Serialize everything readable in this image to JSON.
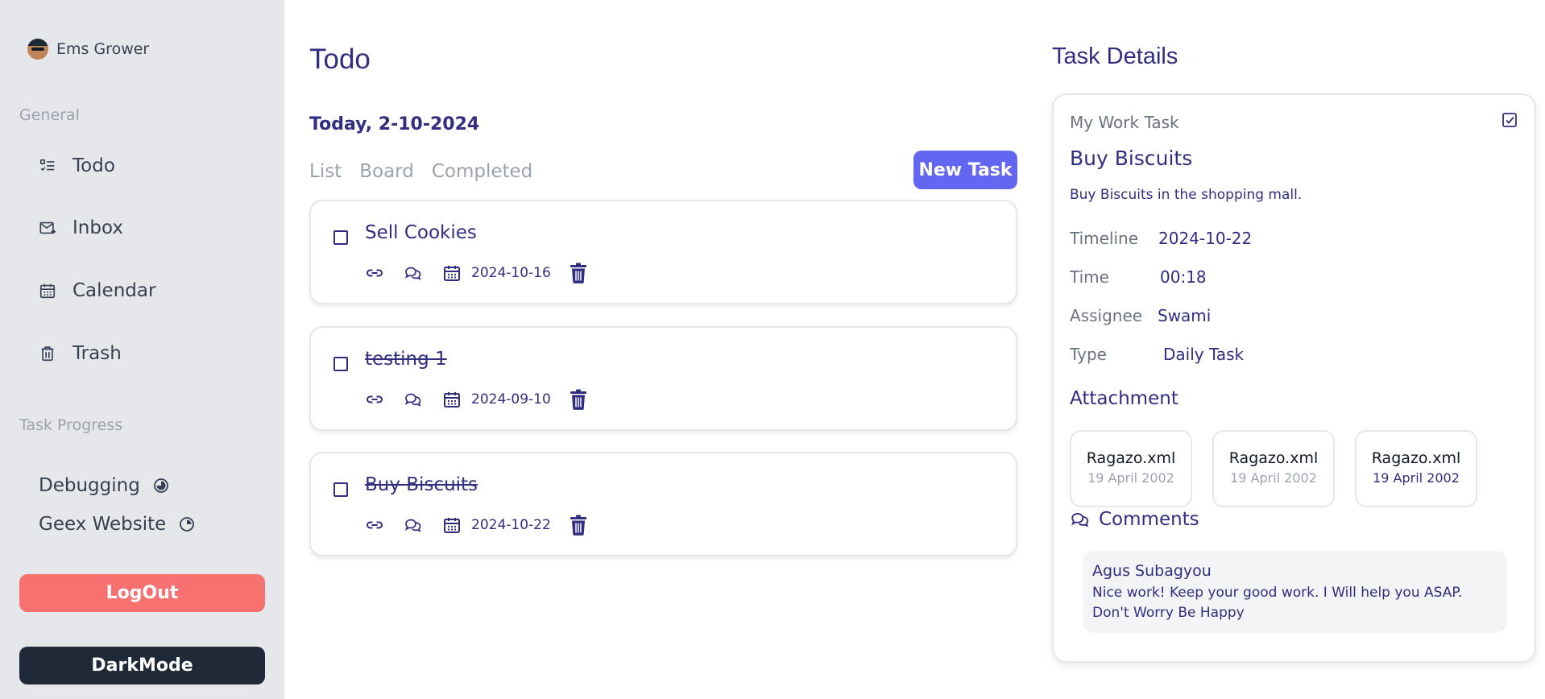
{
  "sidebar": {
    "user_name": "Ems Grower",
    "general_label": "General",
    "nav": [
      {
        "label": "Todo",
        "icon": "todo-list-icon"
      },
      {
        "label": "Inbox",
        "icon": "inbox-icon"
      },
      {
        "label": "Calendar",
        "icon": "calendar-icon"
      },
      {
        "label": "Trash",
        "icon": "trash-icon"
      }
    ],
    "progress_label": "Task Progress",
    "progress": [
      {
        "label": "Debugging",
        "icon": "pie-progress-icon"
      },
      {
        "label": "Geex Website",
        "icon": "pie-progress-icon"
      }
    ],
    "logout_label": "LogOut",
    "darkmode_label": "DarkMode"
  },
  "main": {
    "title": "Todo",
    "date_heading": "Today, 2-10-2024",
    "tabs": [
      "List",
      "Board",
      "Completed"
    ],
    "new_task_label": "New Task",
    "tasks": [
      {
        "title": "Sell Cookies",
        "date": "2024-10-16",
        "completed": false
      },
      {
        "title": "testing 1",
        "date": "2024-09-10",
        "completed": true
      },
      {
        "title": "Buy Biscuits",
        "date": "2024-10-22",
        "completed": true
      }
    ]
  },
  "details": {
    "heading": "Task Details",
    "category": "My Work Task",
    "name": "Buy Biscuits",
    "description": "Buy Biscuits in the shopping mall.",
    "fields": [
      {
        "key": "Timeline",
        "value": "2024-10-22"
      },
      {
        "key": "Time",
        "value": "00:18"
      },
      {
        "key": "Assignee",
        "value": "Swami"
      },
      {
        "key": "Type",
        "value": "Daily Task"
      }
    ],
    "attachment_label": "Attachment",
    "attachments": [
      {
        "name": "Ragazo.xml",
        "date": "19 April 2002"
      },
      {
        "name": "Ragazo.xml",
        "date": "19 April 2002"
      },
      {
        "name": "Ragazo.xml",
        "date": "19 April 2002"
      }
    ],
    "comments_label": "Comments",
    "comment": {
      "author": "Agus Subagyou",
      "text": "Nice work! Keep your good work. I Will help you ASAP. Don't Worry Be Happy"
    }
  },
  "colors": {
    "primary": "#312e81",
    "accent": "#6366f1",
    "logout": "#f87171",
    "darkmode": "#1f2937",
    "sidebar_bg": "#e5e7eb"
  }
}
